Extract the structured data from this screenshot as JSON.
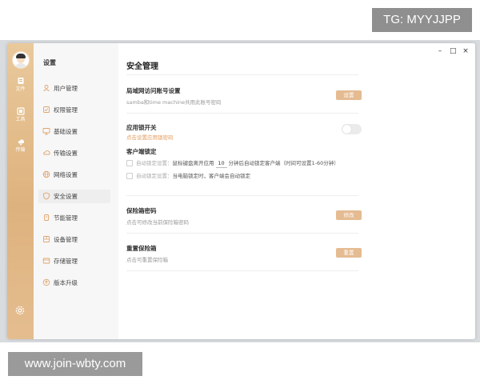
{
  "watermarks": {
    "top": "TG: MYYJJPP",
    "bottom": "www.join-wbty.com"
  },
  "rail": {
    "items": [
      {
        "label": "文件",
        "icon": "file-icon"
      },
      {
        "label": "工具",
        "icon": "tools-icon"
      },
      {
        "label": "传输",
        "icon": "transfer-icon"
      }
    ],
    "settings_icon": "gear-icon"
  },
  "nav": {
    "title": "设置",
    "items": [
      {
        "label": "用户管理",
        "icon": "user-icon"
      },
      {
        "label": "权限管理",
        "icon": "permission-icon"
      },
      {
        "label": "基础设置",
        "icon": "monitor-icon"
      },
      {
        "label": "传输设置",
        "icon": "transfer-icon"
      },
      {
        "label": "网络设置",
        "icon": "globe-icon"
      },
      {
        "label": "安全设置",
        "icon": "shield-icon"
      },
      {
        "label": "节能管理",
        "icon": "power-icon"
      },
      {
        "label": "设备管理",
        "icon": "device-icon"
      },
      {
        "label": "存储管理",
        "icon": "storage-icon"
      },
      {
        "label": "版本升级",
        "icon": "upgrade-icon"
      }
    ],
    "active_index": 5
  },
  "window_controls": {
    "minimize": "–",
    "maximize": "□",
    "close": "×"
  },
  "main": {
    "title": "安全管理",
    "lan_account": {
      "title": "局域网访问账号设置",
      "desc": "samba和time machine共用此账号密码",
      "button": "设置"
    },
    "app_lock": {
      "title": "应用锁开关",
      "desc": "点击设置应用锁密码",
      "enabled": false
    },
    "client_lock": {
      "title": "客户端锁定",
      "option1": {
        "prefix": "自动锁定设置：",
        "text_before": "鼠标键盘离开应用",
        "value": "10",
        "text_after": "分钟后自动锁定客户端（时间可设置1-60分钟）"
      },
      "option2": {
        "prefix": "自动锁定设置：",
        "text": "当电脑锁定时，客户端会自动锁定"
      }
    },
    "safe_password": {
      "title": "保险箱密码",
      "desc": "点击可修改当前保险箱密码",
      "button": "修改"
    },
    "reset_safe": {
      "title": "重置保险箱",
      "desc": "点击可重置保险箱",
      "button": "重置"
    }
  },
  "colors": {
    "accent": "#e5bb92",
    "rail": "#deb27e",
    "warn_text": "#e49a5a"
  }
}
